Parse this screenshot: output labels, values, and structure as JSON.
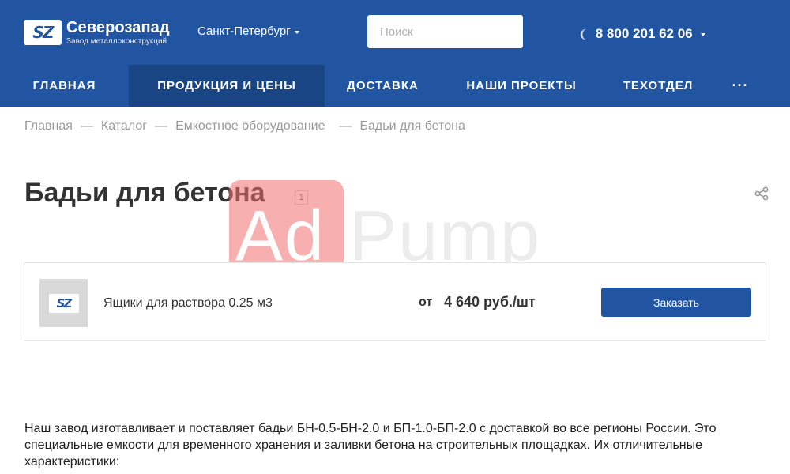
{
  "header": {
    "logo": {
      "name": "Северозапад",
      "subtitle": "Завод металлоконструкций",
      "mark": "SZ"
    },
    "city": "Санкт-Петербург",
    "search": {
      "placeholder": "Поиск",
      "value": ""
    },
    "phone": "8 800 201 62 06",
    "icons": {
      "city_caret": "chevron-down-icon",
      "phone": "phone-icon",
      "phone_caret": "chevron-down-icon"
    }
  },
  "nav": {
    "items": [
      {
        "label": "Главная",
        "active": false
      },
      {
        "label": "Продукция и цены",
        "active": true
      },
      {
        "label": "Доставка",
        "active": false
      },
      {
        "label": "Наши проекты",
        "active": false
      },
      {
        "label": "Техотдел",
        "active": false
      }
    ],
    "more": "···"
  },
  "breadcrumb": [
    "Главная",
    "Каталог",
    "Емкостное оборудование",
    "Бадьи для бетона"
  ],
  "page": {
    "title": "Бадьи для бетона",
    "count": "1",
    "share_icon": "share-icon"
  },
  "watermark": {
    "left": "Ad",
    "right": "Pump"
  },
  "products": [
    {
      "name": "Ящики для раствора 0.25 м3",
      "price_prefix": "от",
      "price": "4 640 руб./шт",
      "button": "Заказать"
    }
  ],
  "description": "Наш завод изготавливает и поставляет бадьи БН-0.5-БН-2.0 и БП-1.0-БП-2.0 с доставкой во все регионы России. Это специальные емкости для временного хранения и заливки бетона на строительных площадках. Их отличительные характеристики:",
  "colors": {
    "brand": "#2155a2",
    "nav_active": "#1a4585",
    "muted_text": "#999999"
  }
}
